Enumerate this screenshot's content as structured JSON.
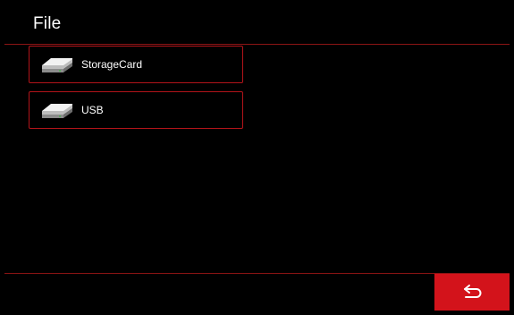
{
  "header": {
    "title": "File"
  },
  "storage": {
    "items": [
      {
        "label": "StorageCard",
        "icon": "drive-icon"
      },
      {
        "label": "USB",
        "icon": "drive-icon"
      }
    ]
  },
  "footer": {
    "back_icon": "back-arrow-icon"
  },
  "colors": {
    "background": "#000000",
    "accent": "#d3131b",
    "border": "#b3141a",
    "divider": "#8a1414",
    "text": "#ffffff"
  }
}
